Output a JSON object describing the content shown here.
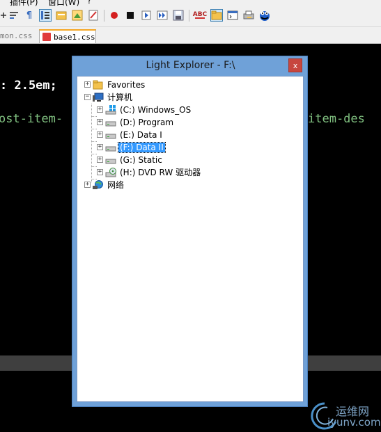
{
  "menu": {
    "items": [
      "插件(P)",
      "窗口(W)",
      "?"
    ]
  },
  "tabs": [
    {
      "label": "mon.css"
    },
    {
      "label": "base1.css"
    }
  ],
  "editor": {
    "line1": ": 2.5em;",
    "line2_left": "ost-item-",
    "line2_right": "item-des"
  },
  "dialog": {
    "title": "Light Explorer - F:\\",
    "close_label": "x",
    "tree": {
      "favorites": "Favorites",
      "computer": "计算机",
      "drives": [
        {
          "label": "(C:) Windows_OS"
        },
        {
          "label": "(D:) Program"
        },
        {
          "label": "(E:) Data I"
        },
        {
          "label": "(F:) Data II"
        },
        {
          "label": "(G:) Static"
        },
        {
          "label": "(H:) DVD RW 驱动器"
        }
      ],
      "network": "网络",
      "selected": "(F:) Data II"
    }
  },
  "watermark": {
    "top": "运维网",
    "bottom": "iyunv.com"
  },
  "colors": {
    "accent": "#3399ff",
    "dialog_frame": "#6fa1d8",
    "close": "#c7463f",
    "code_white": "#ffffff",
    "code_green": "#7fbf7f"
  }
}
